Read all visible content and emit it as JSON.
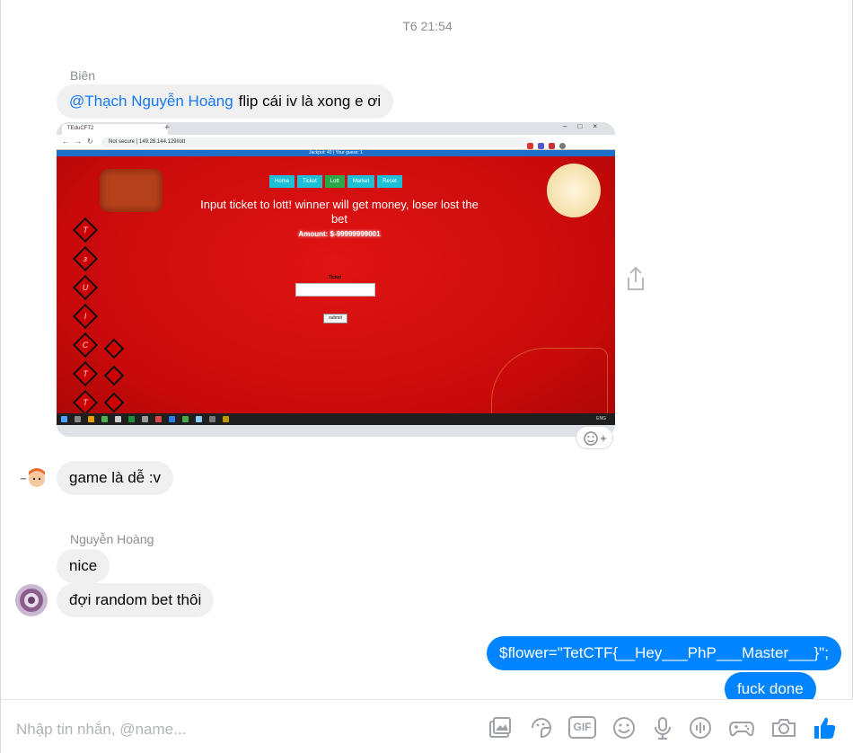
{
  "timestamp": "T6 21:54",
  "messages": [
    {
      "sender": "Biên",
      "mention": "@Thạch Nguyễn Hoàng",
      "text": "flip cái iv là xong e ơi"
    },
    {
      "text": "game là dễ :v"
    },
    {
      "sender": "Nguyễn Hoàng",
      "text": "nice"
    },
    {
      "text": "đợi random bet thôi"
    },
    {
      "text": "$flower=\"TetCTF{__Hey___PhP___Master___}\";"
    },
    {
      "text": "fuck done"
    }
  ],
  "screenshot": {
    "tab_title": "TEduCFT2",
    "url": "Not secure  |  149.28.144.129/lott",
    "jackpot": "Jackpot: 40 | Your guess: 1",
    "nav": [
      "Home",
      "Ticket",
      "Lott",
      "Market",
      "Reset"
    ],
    "headline": "Input ticket to lott! winner will get money, loser lost the bet",
    "amount": "Amount: $-99999999001",
    "ticket_label": "Ticket",
    "submit_label": "submit",
    "lantern_chars": [
      "T",
      "ɜ",
      "U",
      "I",
      "C",
      "T",
      "T"
    ],
    "tray": "ENG"
  },
  "composer": {
    "placeholder": "Nhập tin nhắn, @name...",
    "gif_label": "GIF"
  },
  "colors": {
    "my_bubble": "#0084ff",
    "other_bubble": "#f0f0f0",
    "mention": "#1877f2",
    "like": "#0084ff"
  },
  "icons": [
    "share-icon",
    "add-reaction-icon",
    "image-icon",
    "sticker-icon",
    "gif-icon",
    "emoji-icon",
    "microphone-icon",
    "audio-wave-icon",
    "game-controller-icon",
    "camera-icon",
    "like-icon"
  ]
}
